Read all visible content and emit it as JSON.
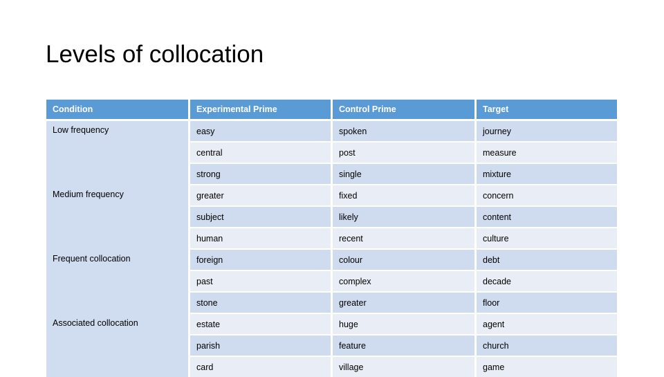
{
  "slide": {
    "title": "Levels of collocation"
  },
  "colors": {
    "header_band": "#5B9BD5",
    "header_text": "#FFFFFF",
    "condition_column": "#D0DCEF",
    "row_band_dark": "#CFDBEE",
    "row_band_light": "#E9EDF5",
    "body_text": "#000000",
    "slide_background": "#FFFFFF"
  },
  "table": {
    "headers": [
      "Condition",
      "Experimental Prime",
      "Control Prime",
      "Target"
    ],
    "groups": [
      {
        "condition": "Low frequency",
        "rows": [
          {
            "experimental_prime": "easy",
            "control_prime": "spoken",
            "target": "journey"
          },
          {
            "experimental_prime": "central",
            "control_prime": "post",
            "target": "measure"
          },
          {
            "experimental_prime": "strong",
            "control_prime": "single",
            "target": "mixture"
          }
        ]
      },
      {
        "condition": "Medium frequency",
        "rows": [
          {
            "experimental_prime": "greater",
            "control_prime": "fixed",
            "target": "concern"
          },
          {
            "experimental_prime": "subject",
            "control_prime": "likely",
            "target": "content"
          },
          {
            "experimental_prime": "human",
            "control_prime": "recent",
            "target": "culture"
          }
        ]
      },
      {
        "condition": "Frequent collocation",
        "rows": [
          {
            "experimental_prime": "foreign",
            "control_prime": "colour",
            "target": "debt"
          },
          {
            "experimental_prime": "past",
            "control_prime": "complex",
            "target": "decade"
          },
          {
            "experimental_prime": "stone",
            "control_prime": "greater",
            "target": "floor"
          }
        ]
      },
      {
        "condition": "Associated collocation",
        "rows": [
          {
            "experimental_prime": "estate",
            "control_prime": "huge",
            "target": "agent"
          },
          {
            "experimental_prime": "parish",
            "control_prime": "feature",
            "target": "church"
          },
          {
            "experimental_prime": "card",
            "control_prime": "village",
            "target": "game"
          }
        ]
      }
    ]
  }
}
